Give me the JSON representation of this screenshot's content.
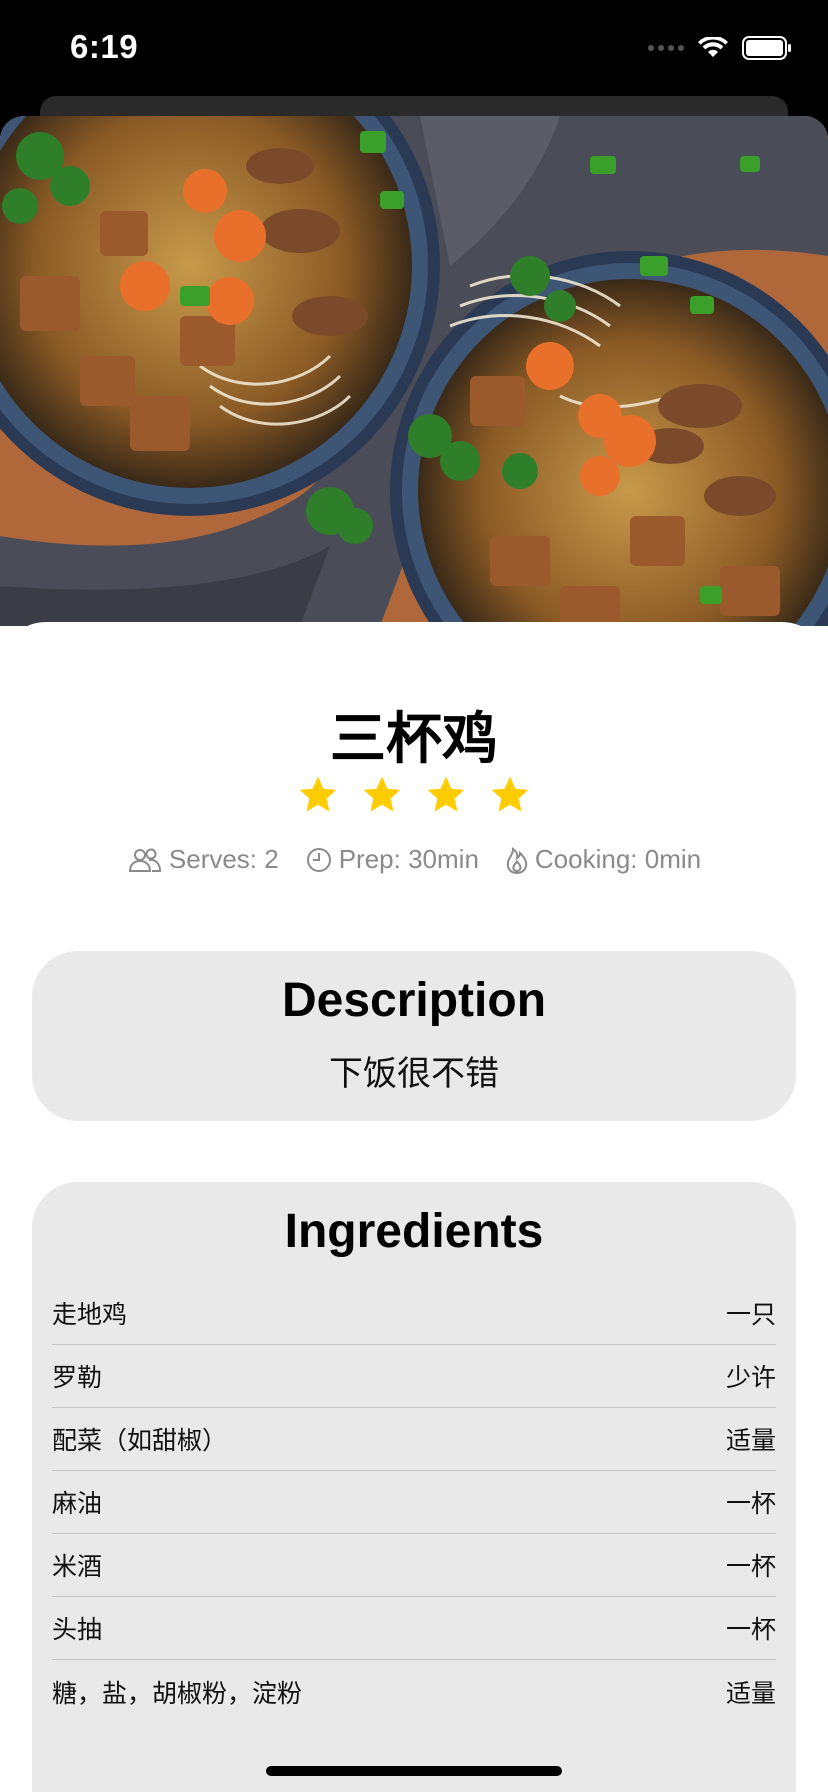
{
  "status_bar": {
    "time": "6:19"
  },
  "recipe": {
    "title": "三杯鸡",
    "rating": 4,
    "rating_max": 4,
    "serves": "Serves: 2",
    "prep": "Prep: 30min",
    "cooking": "Cooking: 0min"
  },
  "description": {
    "heading": "Description",
    "text": "下饭很不错"
  },
  "ingredients": {
    "heading": "Ingredients",
    "items": [
      {
        "name": "走地鸡",
        "qty": "一只"
      },
      {
        "name": "罗勒",
        "qty": "少许"
      },
      {
        "name": "配菜（如甜椒）",
        "qty": "适量"
      },
      {
        "name": "麻油",
        "qty": "一杯"
      },
      {
        "name": "米酒",
        "qty": "一杯"
      },
      {
        "name": "头抽",
        "qty": "一杯"
      },
      {
        "name": "糖，盐，胡椒粉，淀粉",
        "qty": "适量"
      }
    ]
  },
  "colors": {
    "star": "#FFCC00",
    "meta_text": "#8A8A8E",
    "card_bg": "#E9E9E9"
  },
  "icons": {
    "serves": "people-icon",
    "prep": "clock-icon",
    "cooking": "flame-icon"
  }
}
